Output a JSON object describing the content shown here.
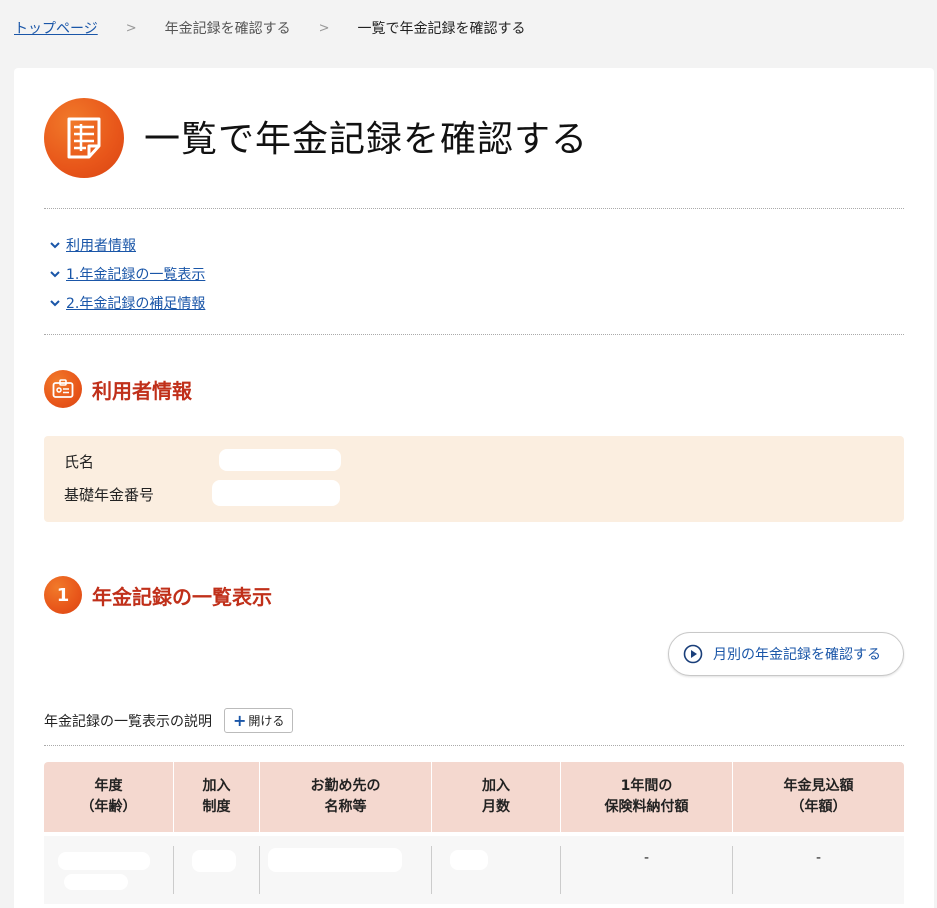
{
  "breadcrumb": {
    "top": "トップページ",
    "mid": "年金記録を確認する",
    "current": "一覧で年金記録を確認する",
    "separator": ">"
  },
  "page": {
    "title": "一覧で年金記録を確認する",
    "icon": "document-table-icon",
    "accent_color": "#e8561a",
    "heading_color": "#c0301a",
    "link_color": "#1a56a8"
  },
  "toc": [
    {
      "label": "利用者情報"
    },
    {
      "label": "1.年金記録の一覧表示"
    },
    {
      "label": "2.年金記録の補足情報"
    }
  ],
  "user_section": {
    "title": "利用者情報",
    "icon": "id-card-icon",
    "rows": [
      {
        "label": "氏名"
      },
      {
        "label": "基礎年金番号"
      }
    ]
  },
  "records_section": {
    "number": "1",
    "title": "年金記録の一覧表示",
    "monthly_button": "月別の年金記録を確認する",
    "explain_label": "年金記録の一覧表示の説明",
    "open_button": "開ける",
    "open_button_symbol": "+",
    "columns": [
      {
        "line1": "年度",
        "line2": "（年齢）"
      },
      {
        "line1": "加入",
        "line2": "制度"
      },
      {
        "line1": "お勤め先の",
        "line2": "名称等"
      },
      {
        "line1": "加入",
        "line2": "月数"
      },
      {
        "line1": "1年間の",
        "line2": "保険料納付額"
      },
      {
        "line1": "年金見込額",
        "line2": "（年額）"
      }
    ],
    "rows": [
      {
        "premium": "-",
        "estimate": "-"
      }
    ]
  }
}
